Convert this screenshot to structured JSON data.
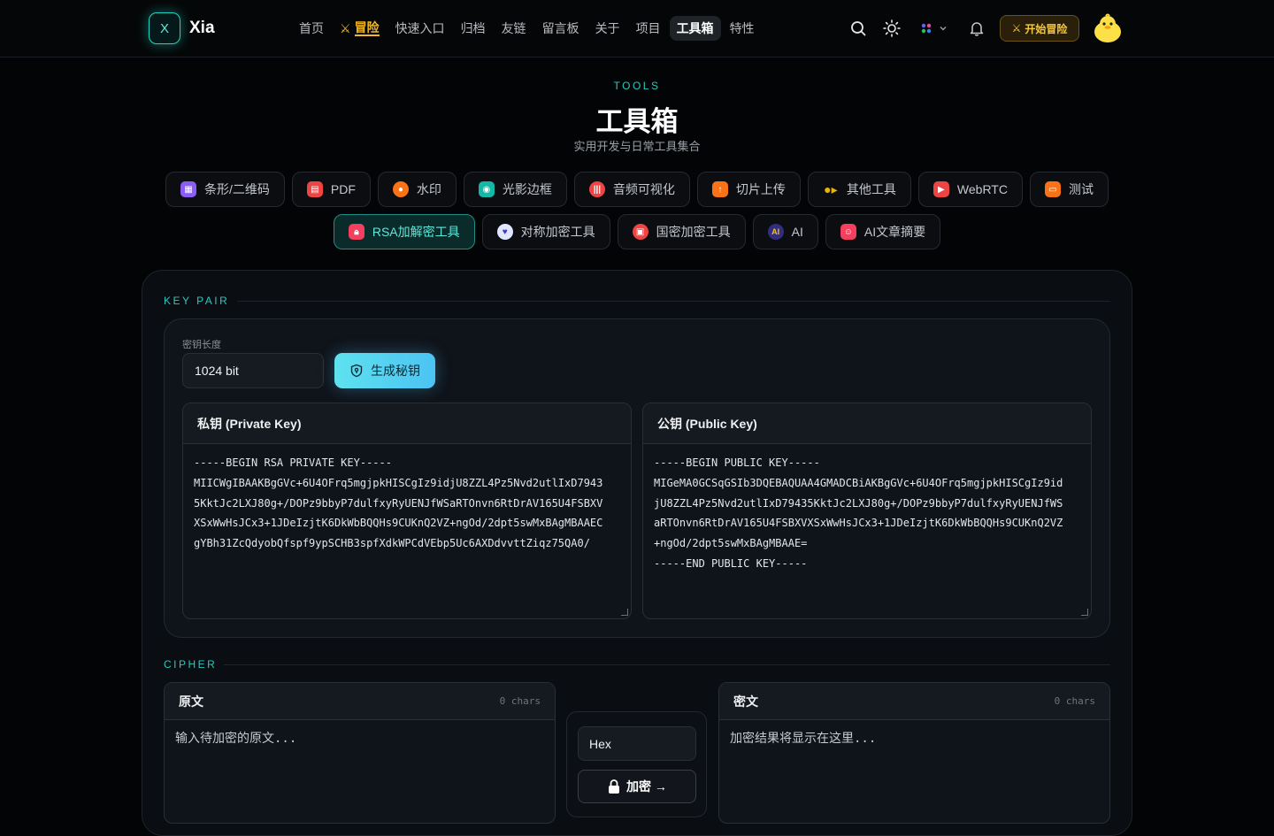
{
  "brand": {
    "logo_letter": "X",
    "name": "Xia"
  },
  "nav": {
    "items": [
      {
        "label": "首页"
      },
      {
        "label": "冒险"
      },
      {
        "label": "快速入口"
      },
      {
        "label": "归档"
      },
      {
        "label": "友链"
      },
      {
        "label": "留言板"
      },
      {
        "label": "关于"
      },
      {
        "label": "项目"
      },
      {
        "label": "工具箱"
      },
      {
        "label": "特性"
      }
    ],
    "active": "工具箱"
  },
  "header": {
    "start_button": "开始冒险"
  },
  "hero": {
    "eyebrow": "TOOLS",
    "title": "工具箱",
    "subtitle": "实用开发与日常工具集合"
  },
  "tools": {
    "row1": [
      {
        "label": "条形/二维码",
        "icon": "qrcode-icon",
        "color": "#8b5cf6"
      },
      {
        "label": "PDF",
        "icon": "pdf-icon",
        "color": "#ef4444"
      },
      {
        "label": "水印",
        "icon": "watermark-icon",
        "color": "#f97316"
      },
      {
        "label": "光影边框",
        "icon": "camera-icon",
        "color": "#14b8a6"
      },
      {
        "label": "音频可视化",
        "icon": "audio-icon",
        "color": "#ef4444"
      },
      {
        "label": "切片上传",
        "icon": "upload-icon",
        "color": "#f97316"
      },
      {
        "label": "其他工具",
        "icon": "key-icon",
        "color": "#eab308"
      },
      {
        "label": "WebRTC",
        "icon": "video-icon",
        "color": "#ef4444"
      },
      {
        "label": "测试",
        "icon": "presentation-icon",
        "color": "#f97316"
      }
    ],
    "row2": [
      {
        "label": "RSA加解密工具",
        "icon": "lock-icon",
        "color": "#f43f5e"
      },
      {
        "label": "对称加密工具",
        "icon": "shield-icon",
        "color": "#6366f1"
      },
      {
        "label": "国密加密工具",
        "icon": "lock-icon",
        "color": "#ef4444"
      },
      {
        "label": "AI",
        "icon": "ai-icon",
        "color": "#4338ca"
      },
      {
        "label": "AI文章摘要",
        "icon": "robot-icon",
        "color": "#f43f5e"
      }
    ],
    "active": "RSA加解密工具"
  },
  "keypair": {
    "section_label": "KEY PAIR",
    "length_label": "密钥长度",
    "length_value": "1024 bit",
    "generate_button": "生成秘钥",
    "private_title": "私钥 (Private Key)",
    "private_key": "-----BEGIN RSA PRIVATE KEY-----\nMIICWgIBAAKBgGVc+6U4OFrq5mgjpkHISCgIz9idjU8ZZL4Pz5Nvd2utlIxD7943\n5KktJc2LXJ80g+/DOPz9bbyP7dulfxyRyUENJfWSaRTOnvn6RtDrAV165U4FSBXV\nXSxWwHsJCx3+1JDeIzjtK6DkWbBQQHs9CUKnQ2VZ+ngOd/2dpt5swMxBAgMBAAEC\ngYBh31ZcQdyobQfspf9ypSCHB3spfXdkWPCdVEbp5Uc6AXDdvvttZiqz75QA0/",
    "public_title": "公钥 (Public Key)",
    "public_key": "-----BEGIN PUBLIC KEY-----\nMIGeMA0GCSqGSIb3DQEBAQUAA4GMADCBiAKBgGVc+6U4OFrq5mgjpkHISCgIz9id\njU8ZZL4Pz5Nvd2utlIxD79435KktJc2LXJ80g+/DOPz9bbyP7dulfxyRyUENJfWS\naRTOnvn6RtDrAV165U4FSBXVXSxWwHsJCx3+1JDeIzjtK6DkWbBQQHs9CUKnQ2VZ\n+ngOd/2dpt5swMxBAgMBAAE=\n-----END PUBLIC KEY-----"
  },
  "cipher": {
    "section_label": "CIPHER",
    "plain_title": "原文",
    "plain_chars": "0 chars",
    "plain_placeholder": "输入待加密的原文...",
    "cipher_title": "密文",
    "cipher_chars": "0 chars",
    "cipher_placeholder": "加密结果将显示在这里...",
    "format_value": "Hex",
    "encrypt_button": "加密 →"
  }
}
